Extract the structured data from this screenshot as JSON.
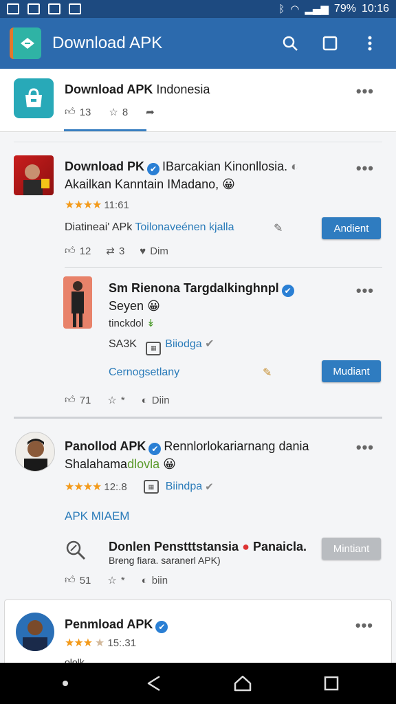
{
  "status_bar": {
    "battery": "79%",
    "time": "10:16"
  },
  "app_bar": {
    "title": "Download APK"
  },
  "header_card": {
    "title_bold": "Download APK",
    "title_rest": "Indonesia",
    "likes": "13",
    "stars": "8"
  },
  "post1": {
    "title_bold": "Download PK",
    "title_rest": "IBarcakian Kinonllosia.",
    "subtitle": "Akailkan Kanntain IMadano,",
    "rating": "11:61",
    "desc_left": "Diatineai' APk",
    "desc_link": "Toilonaveénen kjalla",
    "button": "Andient",
    "likes": "12",
    "reposts": "3",
    "react": "Dim"
  },
  "post2": {
    "title": "Sm Rienona Targdalkinghnpl",
    "subtitle": "Seyen",
    "tag": "tinckdol",
    "count": "SA3K",
    "link": "Biiodga",
    "link_row": "Cernogsetlany",
    "button": "Mudiant",
    "likes": "71",
    "stars": "*",
    "react": "Diin"
  },
  "post3": {
    "title_bold": "Panollod APK",
    "title_rest": "Rennlorlokariarnang dania",
    "subtitle_a": "Shalahama",
    "subtitle_b": "dlovla",
    "rating": "12:.8",
    "link": "Biindpa",
    "section_label": "APK MIAEM",
    "sub_title": "Donlen Penstttstansia",
    "sub_title_b": "Panaicla.",
    "sub_desc": "Breng fiara. saranerl APK)",
    "button": "Mintiant",
    "likes": "51",
    "stars": "*",
    "react": "biin"
  },
  "post4": {
    "title_bold": "Penmload APK",
    "rating": "15:.31",
    "cut_text": "ololk"
  },
  "colors": {
    "app_bar": "#2c6aad",
    "status_bar": "#1d4a80",
    "accent": "#2f7cc0",
    "star": "#f39a1a"
  }
}
